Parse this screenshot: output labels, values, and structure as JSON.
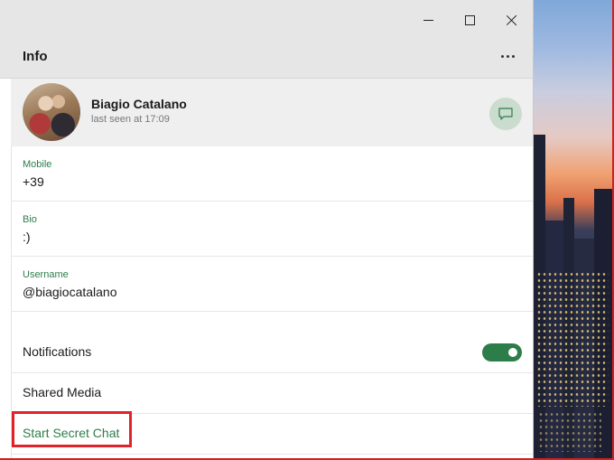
{
  "window": {
    "page_title": "Info",
    "controls": [
      "minimize-icon",
      "maximize-icon",
      "close-icon"
    ],
    "more_icon": "more-icon"
  },
  "profile": {
    "name": "Biagio Catalano",
    "status": "last seen at 17:09",
    "chat_icon": "chat-icon"
  },
  "fields": [
    {
      "label": "Mobile",
      "value": "+39"
    },
    {
      "label": "Bio",
      "value": ":)"
    },
    {
      "label": "Username",
      "value": "@biagiocatalano"
    }
  ],
  "settings": {
    "notifications_label": "Notifications",
    "notifications_on": true,
    "shared_media_label": "Shared Media",
    "secret_chat_label": "Start Secret Chat"
  },
  "colors": {
    "accent": "#2d7d4b",
    "highlight": "#e0232b"
  }
}
